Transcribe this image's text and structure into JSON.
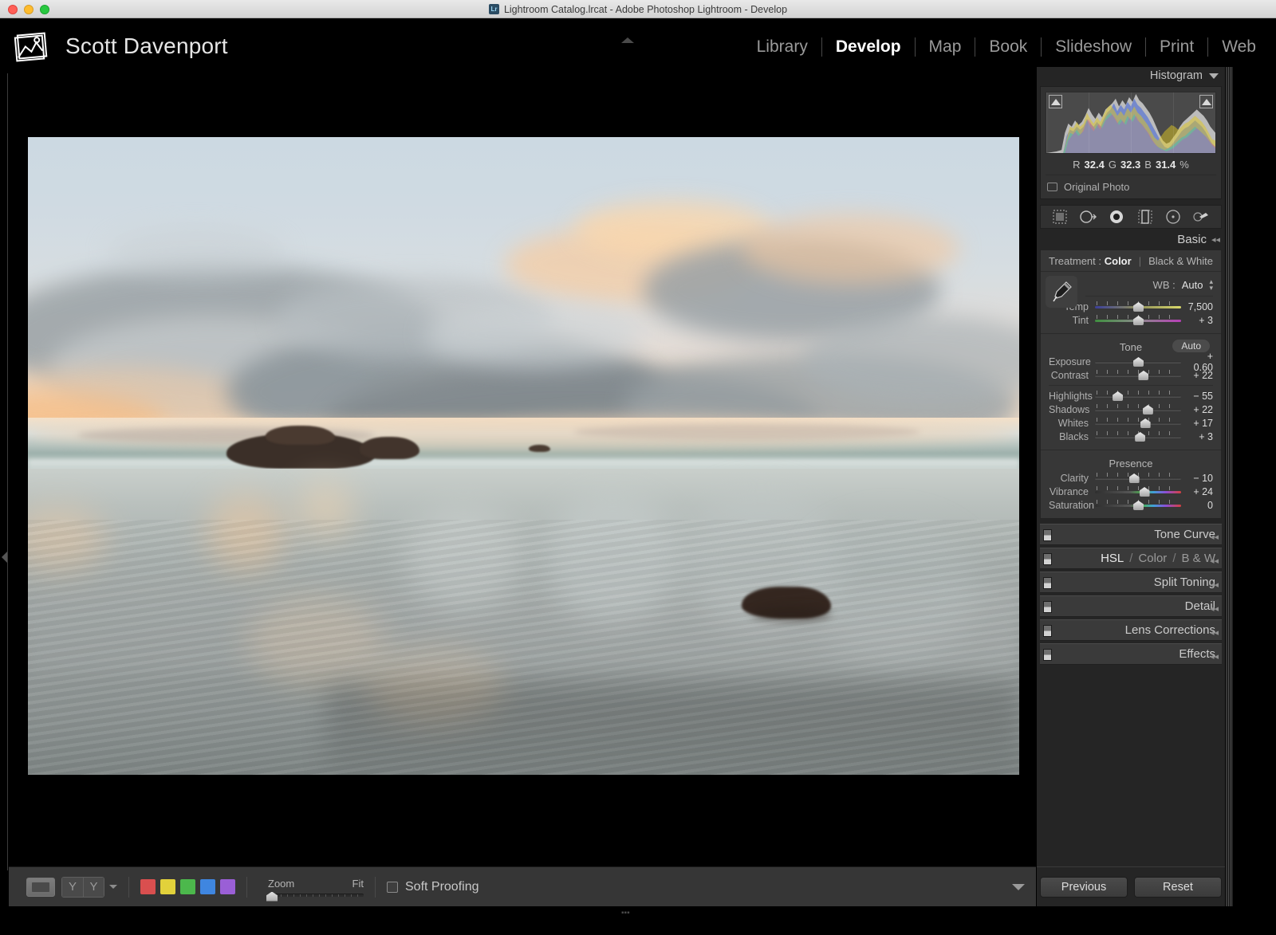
{
  "window": {
    "title": "Lightroom Catalog.lrcat - Adobe Photoshop Lightroom - Develop",
    "app_badge": "Lr"
  },
  "identity": {
    "name": "Scott Davenport",
    "icon": "photo-stack-icon"
  },
  "modules": [
    {
      "label": "Library",
      "active": false
    },
    {
      "label": "Develop",
      "active": true
    },
    {
      "label": "Map",
      "active": false
    },
    {
      "label": "Book",
      "active": false
    },
    {
      "label": "Slideshow",
      "active": false
    },
    {
      "label": "Print",
      "active": false
    },
    {
      "label": "Web",
      "active": false
    }
  ],
  "histogram": {
    "title": "Histogram",
    "readout": {
      "r_label": "R",
      "r": "32.4",
      "g_label": "G",
      "g": "32.3",
      "b_label": "B",
      "b": "31.4",
      "percent": "%"
    },
    "original_photo": "Original Photo"
  },
  "tools": [
    {
      "name": "crop-overlay-tool",
      "label": "Crop Overlay"
    },
    {
      "name": "spot-removal-tool",
      "label": "Spot Removal"
    },
    {
      "name": "red-eye-correction-tool",
      "label": "Red Eye Correction"
    },
    {
      "name": "graduated-filter-tool",
      "label": "Graduated Filter"
    },
    {
      "name": "radial-filter-tool",
      "label": "Radial Filter"
    },
    {
      "name": "adjustment-brush-tool",
      "label": "Adjustment Brush"
    }
  ],
  "basic": {
    "title": "Basic",
    "treatment": {
      "label": "Treatment :",
      "options": [
        "Color",
        "Black & White"
      ],
      "selected": "Color",
      "divider": "|"
    },
    "wb": {
      "label": "WB :",
      "value": "Auto",
      "sliders": [
        {
          "label": "Temp",
          "value": "7,500",
          "pos": 50,
          "gradient": "temp"
        },
        {
          "label": "Tint",
          "value": "+ 3",
          "pos": 50,
          "gradient": "tint"
        }
      ]
    },
    "tone": {
      "title": "Tone",
      "auto_label": "Auto",
      "sliders": [
        {
          "label": "Exposure",
          "value": "+ 0.60",
          "pos": 50
        },
        {
          "label": "Contrast",
          "value": "+ 22",
          "pos": 56
        }
      ],
      "sliders2": [
        {
          "label": "Highlights",
          "value": "− 55",
          "pos": 26
        },
        {
          "label": "Shadows",
          "value": "+ 22",
          "pos": 61
        },
        {
          "label": "Whites",
          "value": "+ 17",
          "pos": 58
        },
        {
          "label": "Blacks",
          "value": "+ 3",
          "pos": 52
        }
      ]
    },
    "presence": {
      "title": "Presence",
      "sliders": [
        {
          "label": "Clarity",
          "value": "− 10",
          "pos": 45,
          "gradient": "none"
        },
        {
          "label": "Vibrance",
          "value": "+ 24",
          "pos": 57,
          "gradient": "sat"
        },
        {
          "label": "Saturation",
          "value": "0",
          "pos": 50,
          "gradient": "sat"
        }
      ]
    }
  },
  "panels": [
    {
      "label": "Tone Curve",
      "type": "plain"
    },
    {
      "label": "HSL / Color / B & W",
      "type": "hsl",
      "parts": [
        "HSL",
        "/",
        "Color",
        "/",
        "B & W"
      ]
    },
    {
      "label": "Split Toning",
      "type": "plain"
    },
    {
      "label": "Detail",
      "type": "plain"
    },
    {
      "label": "Lens Corrections",
      "type": "plain"
    },
    {
      "label": "Effects",
      "type": "plain"
    }
  ],
  "toolbar": {
    "loupe_view": "loupe-view-icon",
    "before_after": "before-after-icon",
    "color_labels": [
      "#d94f4f",
      "#e2d13b",
      "#4cb84c",
      "#3f86e0",
      "#9a5fd6"
    ],
    "zoom_label": "Zoom",
    "zoom_value": "Fit",
    "soft_proofing": "Soft Proofing",
    "soft_proofing_checked": false
  },
  "footer_buttons": {
    "previous": "Previous",
    "reset": "Reset"
  },
  "colors": {
    "panel_bg": "#373737",
    "app_bg": "#000000",
    "accent_text": "#ffffff"
  }
}
